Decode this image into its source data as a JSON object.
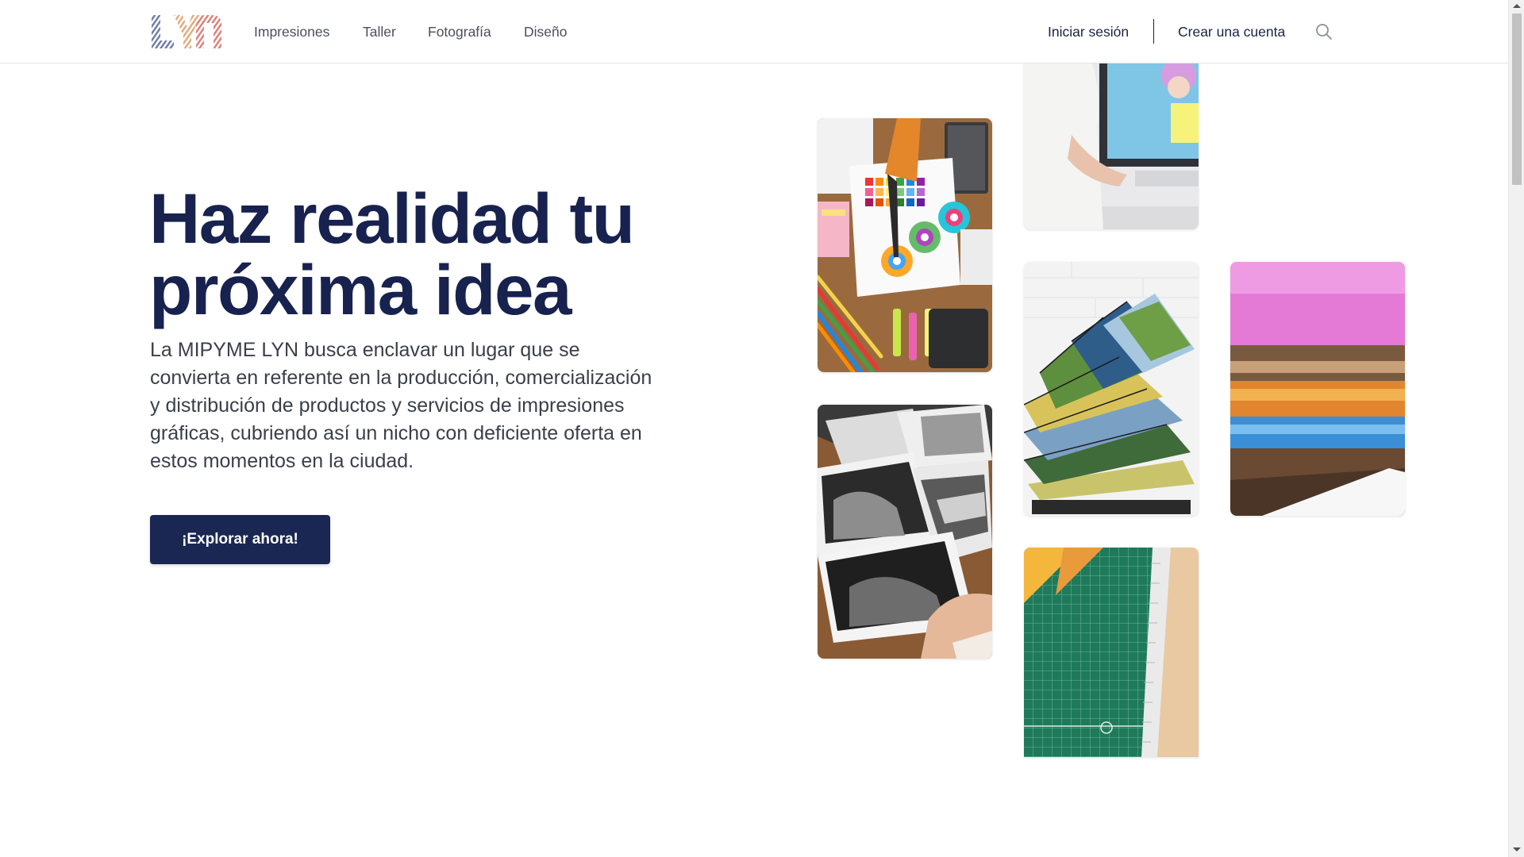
{
  "header": {
    "logo_text": "LYN",
    "nav": [
      "Impresiones",
      "Taller",
      "Fotografía",
      "Diseño"
    ],
    "login_label": "Iniciar sesión",
    "signup_label": "Crear una cuenta",
    "search_icon": "search-icon"
  },
  "hero": {
    "title": "Haz realidad tu próxima idea",
    "description": "La MIPYME LYN busca enclavar un lugar que se convierta en referente en la producción, comercialización y distribución de productos y servicios de impresiones gráficas, cubriendo así un nicho con deficiente oferta en estos momentos en la ciudad.",
    "cta_label": "¡Explorar ahora!"
  },
  "gallery": [
    {
      "name": "designer-at-monitor-photo"
    },
    {
      "name": "color-swatches-desk-photo"
    },
    {
      "name": "photo-books-stack-photo"
    },
    {
      "name": "canvas-prints-stack-photo"
    },
    {
      "name": "black-white-prints-photo"
    },
    {
      "name": "cutting-mat-ruler-photo"
    }
  ],
  "colors": {
    "brand_navy": "#1b2753",
    "title_navy": "#18224f",
    "text_gray": "#3a3f4b",
    "nav_gray": "#4a4f5e"
  }
}
